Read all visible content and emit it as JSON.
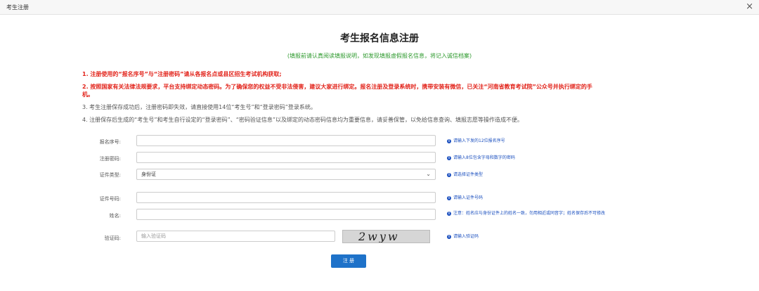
{
  "window": {
    "title": "考生注册"
  },
  "header": {
    "title": "考生报名信息注册",
    "subtitle": "(填报前请认真阅读填报说明，如发现填报虚假报名信息，将记入诚信档案)"
  },
  "notices": [
    "1. 注册使用的“报名序号”与“注册密码”请从各报名点或县区招生考试机构获取;",
    "2. 按照国家有关法律法规要求，平台支持绑定动态密码。为了确保您的权益不受非法侵害，建议大家进行绑定。报名注册及登录系统时，携带安装有微信，已关注“河南省教育考试院”公众号并执行绑定的手",
    "机。",
    "3. 考生注册保存成功后，注册密码即失效，请直接使用14位“考生号”和“登录密码”登录系统。",
    "4. 注册保存后生成的“考生号”和考生自行设定的“登录密码”、“密码验证信息”以及绑定的动态密码信息均为重要信息，请妥善保管，以免给信息查询、填报志愿等操作造成不便。"
  ],
  "form": {
    "reg_no": {
      "label": "报名序号:",
      "value": "",
      "hint": "请输入下发的12位报名序号"
    },
    "reg_pwd": {
      "label": "注册密码:",
      "value": "",
      "hint": "请输入8位包含字母和数字的密码"
    },
    "id_type": {
      "label": "证件类型:",
      "value": "身份证",
      "hint": "请选择证件类型"
    },
    "id_no": {
      "label": "证件号码:",
      "value": "",
      "hint": "请输入证件号码"
    },
    "name": {
      "label": "姓名:",
      "value": "",
      "hint": "注意：姓名应与身份证件上的姓名一致，勿用相近或同音字；姓名保存后不可修改"
    },
    "captcha": {
      "label": "验证码:",
      "placeholder": "输入验证码",
      "image_text": "2wyw",
      "hint": "请输入验证码"
    }
  },
  "submit_label": "注 册",
  "colors": {
    "notice_red": "#e2231a",
    "subtitle_green": "#2e9a2e",
    "hint_blue": "#1a4fbf",
    "button_blue": "#1e72c9"
  }
}
